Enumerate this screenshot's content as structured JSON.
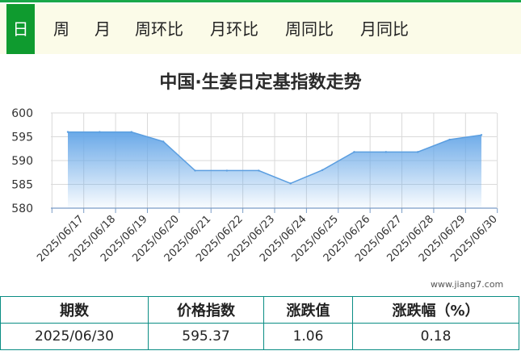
{
  "tabs": [
    {
      "label": "日",
      "active": true
    },
    {
      "label": "周"
    },
    {
      "label": "月"
    },
    {
      "label": "周环比"
    },
    {
      "label": "月环比"
    },
    {
      "label": "周同比"
    },
    {
      "label": "月同比"
    }
  ],
  "colors": {
    "accent": "#0f9b2f",
    "table_border": "#0a8d84",
    "area_top": "#6aa9e8",
    "line": "#5b9ee0"
  },
  "watermark": "www.jiang7.com",
  "chart_data": {
    "type": "area",
    "title": "中国·生姜日定基指数走势",
    "x": [
      "2025/06/17",
      "2025/06/18",
      "2025/06/19",
      "2025/06/20",
      "2025/06/21",
      "2025/06/22",
      "2025/06/23",
      "2025/06/24",
      "2025/06/25",
      "2025/06/26",
      "2025/06/27",
      "2025/06/28",
      "2025/06/29",
      "2025/06/30"
    ],
    "values": [
      596.0,
      596.0,
      596.0,
      594.0,
      587.9,
      587.9,
      587.9,
      585.2,
      588.0,
      591.8,
      591.8,
      591.8,
      594.4,
      595.37
    ],
    "ylim": [
      580,
      600
    ],
    "yticks": [
      580,
      585,
      590,
      595,
      600
    ],
    "grid": true
  },
  "table": {
    "headers": [
      "期数",
      "价格指数",
      "涨跌值",
      "涨跌幅（%）"
    ],
    "row": [
      "2025/06/30",
      "595.37",
      "1.06",
      "0.18"
    ]
  }
}
